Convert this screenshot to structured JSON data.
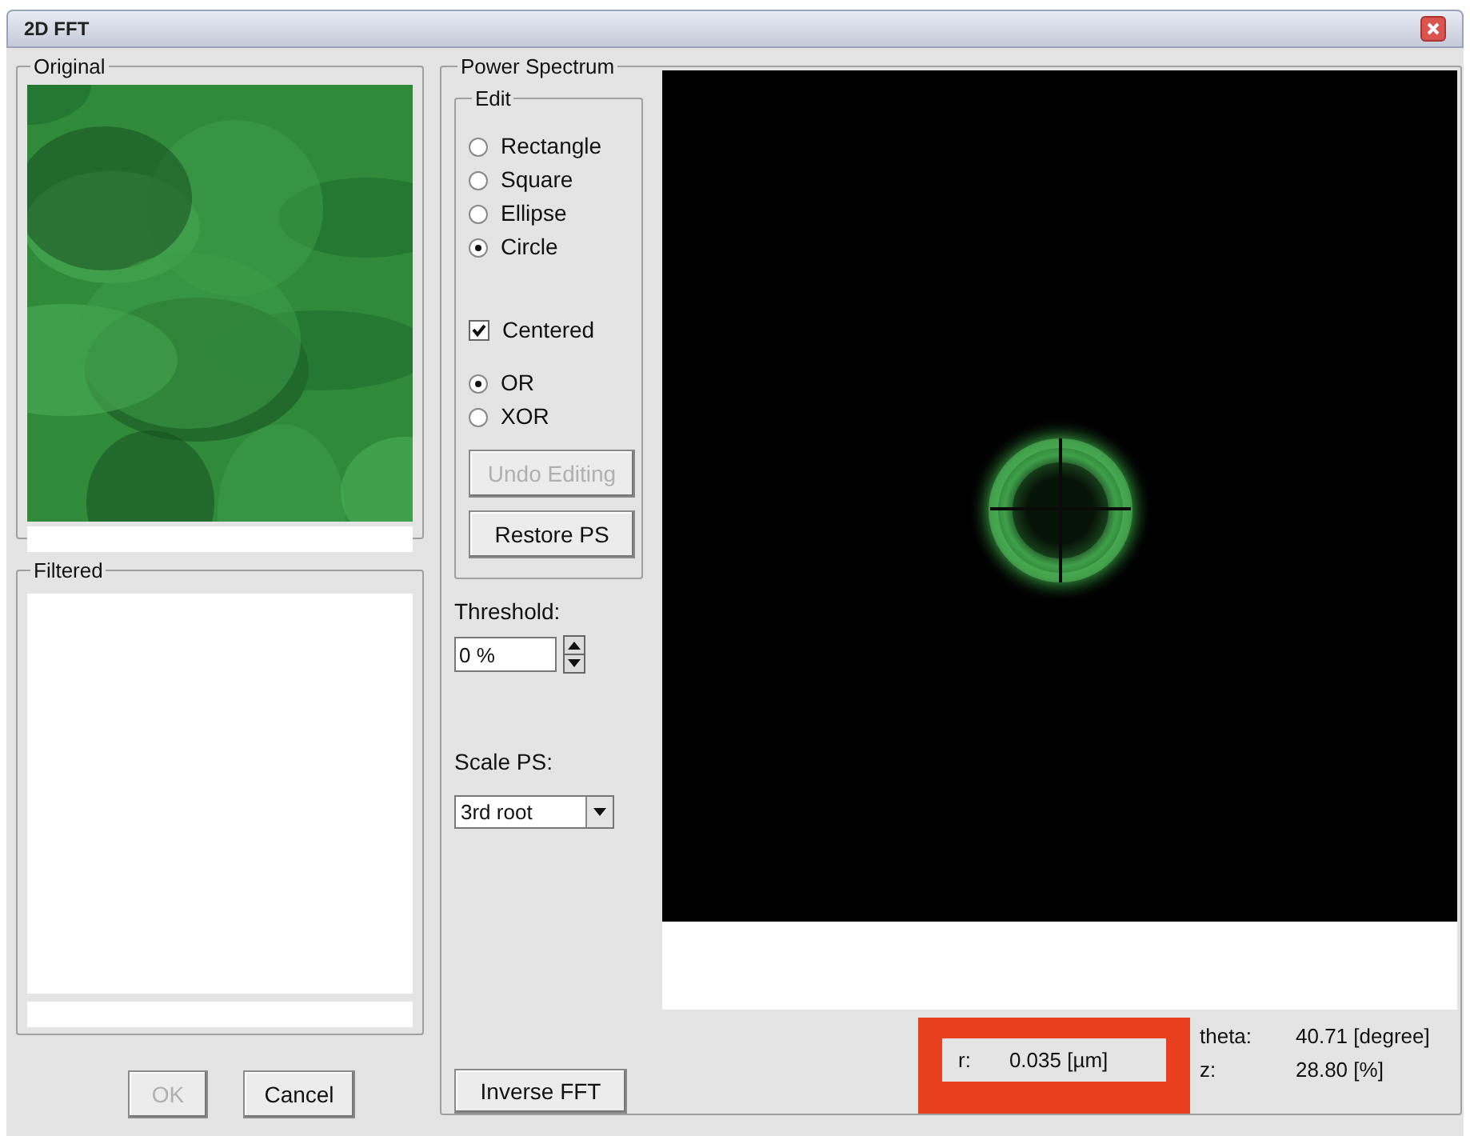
{
  "window": {
    "title": "2D FFT"
  },
  "original": {
    "label": "Original"
  },
  "filtered": {
    "label": "Filtered"
  },
  "power_spectrum": {
    "label": "Power Spectrum",
    "edit": {
      "label": "Edit",
      "shapes": [
        {
          "label": "Rectangle",
          "selected": false
        },
        {
          "label": "Square",
          "selected": false
        },
        {
          "label": "Ellipse",
          "selected": false
        },
        {
          "label": "Circle",
          "selected": true
        }
      ],
      "centered": {
        "label": "Centered",
        "checked": true
      },
      "modes": [
        {
          "label": "OR",
          "selected": true
        },
        {
          "label": "XOR",
          "selected": false
        }
      ],
      "undo": {
        "label": "Undo Editing",
        "disabled": true
      },
      "restore": {
        "label": "Restore PS",
        "disabled": false
      }
    },
    "threshold": {
      "label": "Threshold:",
      "value": "0 %"
    },
    "scale": {
      "label": "Scale PS:",
      "value": "3rd root"
    },
    "inverse": {
      "label": "Inverse FFT",
      "disabled": false
    },
    "readouts": [
      {
        "label": "r:",
        "value": "0.035 [µm]",
        "highlighted": true
      },
      {
        "label": "theta:",
        "value": "40.71 [degree]",
        "highlighted": false
      },
      {
        "label": "z:",
        "value": "28.80 [%]",
        "highlighted": false
      }
    ]
  },
  "buttons": [
    {
      "label": "OK",
      "disabled": true
    },
    {
      "label": "Cancel",
      "disabled": false
    }
  ]
}
